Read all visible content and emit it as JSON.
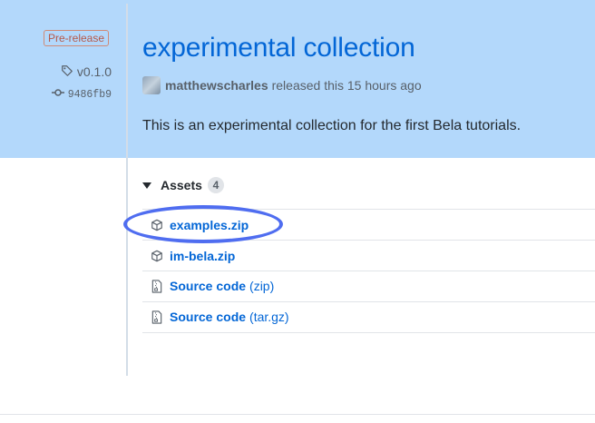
{
  "release": {
    "prerelease_label": "Pre-release",
    "tag": "v0.1.0",
    "commit": "9486fb9",
    "title": "experimental collection",
    "author": "matthewscharles",
    "released_text": "released this 15 hours ago",
    "description": "This is an experimental collection for the first Bela tutorials."
  },
  "assets": {
    "label": "Assets",
    "count": "4",
    "items": [
      {
        "name": "examples.zip",
        "suffix": "",
        "icon": "package-icon"
      },
      {
        "name": "im-bela.zip",
        "suffix": "",
        "icon": "package-icon"
      },
      {
        "name": "Source code",
        "suffix": "(zip)",
        "icon": "file-zip-icon"
      },
      {
        "name": "Source code",
        "suffix": "(tar.gz)",
        "icon": "file-zip-icon"
      }
    ]
  },
  "colors": {
    "highlight": "#b3d8fb",
    "link": "#0366d6",
    "annotation": "#4f6df0",
    "prerelease": "#b6594a"
  }
}
